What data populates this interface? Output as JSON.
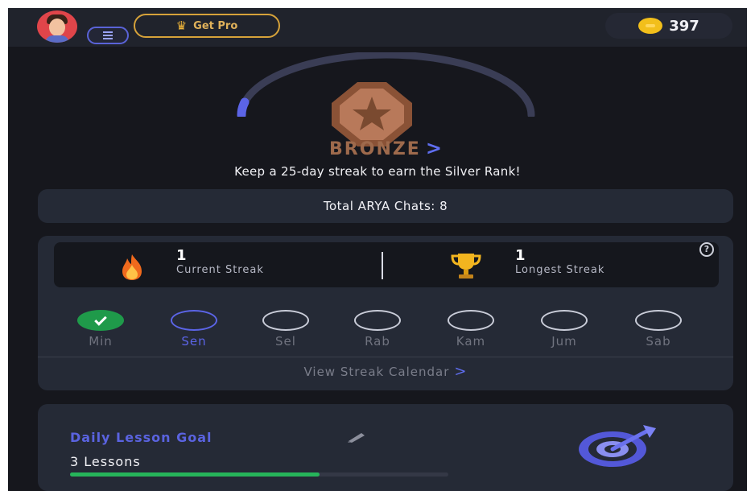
{
  "header": {
    "pro_label": "Get Pro",
    "coins": "397",
    "accent": "#d6a23a"
  },
  "rank": {
    "name": "BRONZE",
    "message": "Keep a 25-day streak to earn the Silver Rank!",
    "progress": 0.03
  },
  "chats": {
    "label": "Total ARYA Chats: 8"
  },
  "streak": {
    "current_value": "1",
    "current_label": "Current Streak",
    "longest_value": "1",
    "longest_label": "Longest Streak",
    "help": "?",
    "days": [
      {
        "label": "Min",
        "state": "done"
      },
      {
        "label": "Sen",
        "state": "today"
      },
      {
        "label": "Sel",
        "state": "empty"
      },
      {
        "label": "Rab",
        "state": "empty"
      },
      {
        "label": "Kam",
        "state": "empty"
      },
      {
        "label": "Jum",
        "state": "empty"
      },
      {
        "label": "Sab",
        "state": "empty"
      }
    ],
    "calendar_link": "View Streak Calendar"
  },
  "goal": {
    "title": "Daily Lesson Goal",
    "value": "3 Lessons",
    "progress": 0.66
  },
  "icons": [
    "avatar",
    "menu-icon",
    "crown-icon",
    "coin-icon",
    "bronze-badge-icon",
    "fire-icon",
    "trophy-icon",
    "check-icon",
    "pencil-icon",
    "target-icon"
  ]
}
